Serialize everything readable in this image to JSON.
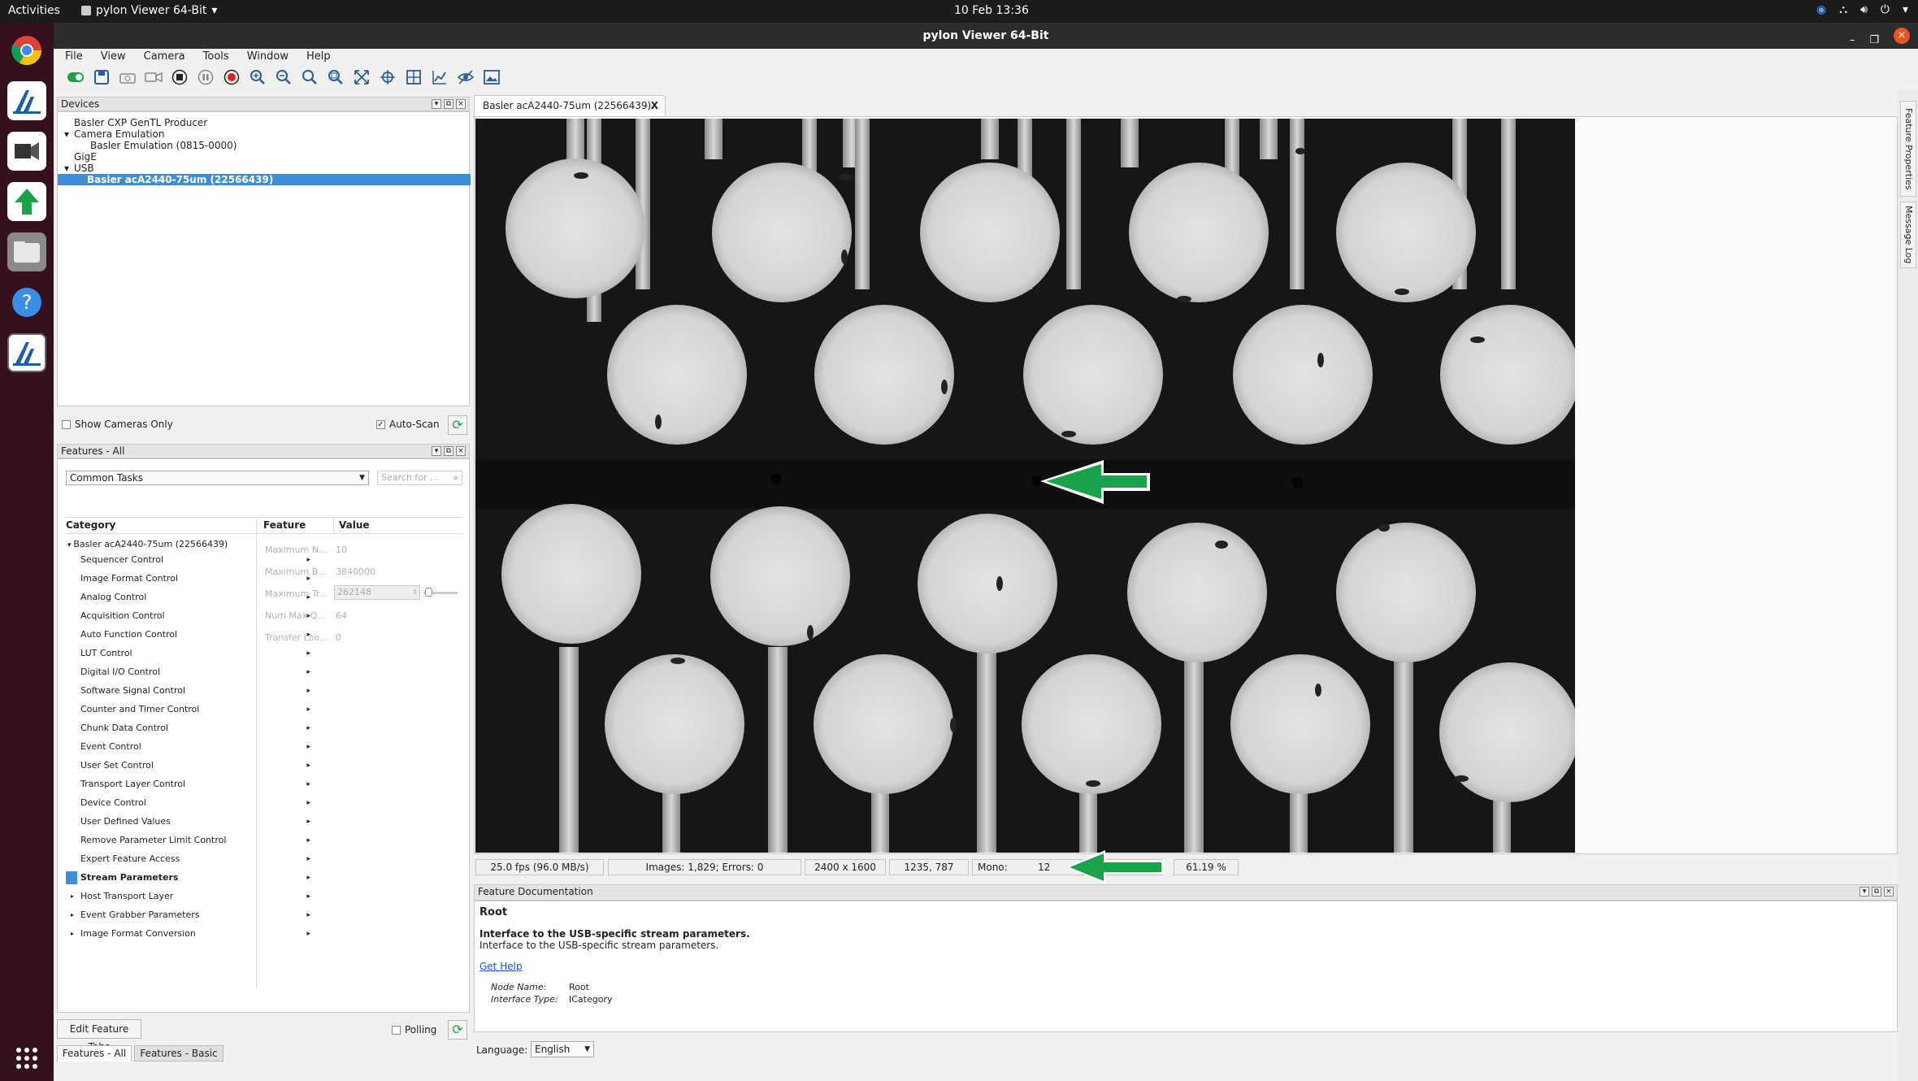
{
  "topbar": {
    "activities": "Activities",
    "app_name": "pylon Viewer 64-Bit",
    "clock": "10 Feb  13:36"
  },
  "window": {
    "title": "pylon Viewer 64-Bit"
  },
  "menu": [
    "File",
    "View",
    "Camera",
    "Tools",
    "Window",
    "Help"
  ],
  "devices": {
    "title": "Devices",
    "tree": [
      {
        "label": "Basler CXP GenTL Producer",
        "level": 0,
        "expander": ""
      },
      {
        "label": "Camera Emulation",
        "level": 0,
        "expander": "▾"
      },
      {
        "label": "Basler Emulation (0815-0000)",
        "level": 1,
        "expander": ""
      },
      {
        "label": "GigE",
        "level": 0,
        "expander": ""
      },
      {
        "label": "USB",
        "level": 0,
        "expander": "▾"
      },
      {
        "label": "Basler acA2440-75um (22566439)",
        "level": 1,
        "expander": "",
        "selected": true
      }
    ],
    "show_cameras_only": "Show Cameras Only",
    "auto_scan": "Auto-Scan"
  },
  "features": {
    "title": "Features - All",
    "dropdown": "Common Tasks",
    "search_placeholder": "Search for ...",
    "col_category": "Category",
    "col_feature": "Feature",
    "col_value": "Value",
    "root": "Basler acA2440-75um (22566439)",
    "categories": [
      "Sequencer Control",
      "Image Format Control",
      "Analog Control",
      "Acquisition Control",
      "Auto Function Control",
      "LUT Control",
      "Digital I/O Control",
      "Software Signal Control",
      "Counter and Timer Control",
      "Chunk Data Control",
      "Event Control",
      "User Set Control",
      "Transport Layer Control",
      "Device Control",
      "User Defined Values",
      "Remove Parameter Limit Control",
      "Expert Feature Access",
      "Stream Parameters",
      "Host Transport Layer",
      "Event Grabber Parameters",
      "Image Format Conversion"
    ],
    "selected_category": "Stream Parameters",
    "feature_rows": [
      {
        "name": "Maximum N...",
        "value": "10"
      },
      {
        "name": "Maximum B...",
        "value": "3840000"
      },
      {
        "name": "Maximum Tr...",
        "value": "262148"
      },
      {
        "name": "Num Max Q...",
        "value": "64"
      },
      {
        "name": "Transfer Loo...",
        "value": "0"
      }
    ],
    "edit_tabs": "Edit Feature Tabs",
    "polling": "Polling",
    "tab_all": "Features - All",
    "tab_basic": "Features - Basic"
  },
  "image_tab": {
    "label": "Basler acA2440-75um (22566439)",
    "close": "X"
  },
  "status": {
    "fps": "25.0 fps (96.0 MB/s)",
    "images": "Images: 1,829; Errors: 0",
    "resolution": "2400 x 1600",
    "coords": "1235, 787",
    "mono_label": "Mono:",
    "mono_value": "12",
    "zoom": "61.19 %"
  },
  "feature_doc": {
    "title": "Feature Documentation",
    "heading": "Root",
    "bold": "Interface to the USB-specific stream parameters.",
    "desc": "Interface to the USB-specific stream parameters.",
    "link": "Get Help",
    "node_name_label": "Node Name:",
    "node_name": "Root",
    "interface_type_label": "Interface Type:",
    "interface_type": "ICategory"
  },
  "language": {
    "label": "Language:",
    "value": "English"
  },
  "side_tabs": {
    "feature_properties": "Feature Properties",
    "message_log": "Message Log"
  },
  "colors": {
    "accent": "#3c8fd6",
    "arrow": "#1aa34a",
    "dock": "#36101f"
  }
}
